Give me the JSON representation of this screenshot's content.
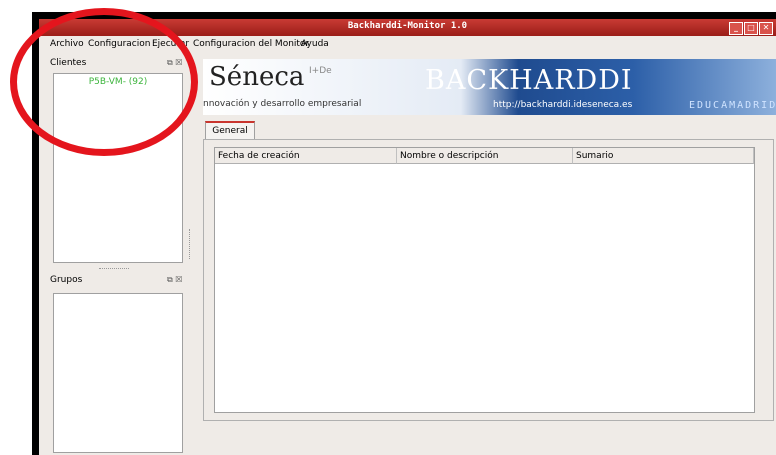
{
  "window": {
    "title": "Backharddi-Monitor 1.0"
  },
  "menu": [
    "Archivo",
    "Configuracion",
    "Ejecutar",
    "Configuracion del Monitor",
    "Ayuda"
  ],
  "clientes": {
    "title": "Clientes",
    "items": [
      "P5B-VM- (92)"
    ]
  },
  "grupos": {
    "title": "Grupos"
  },
  "banner": {
    "seneca": "Séneca",
    "ide": "I+De",
    "tagline": "nnovación y desarrollo empresarial",
    "backharddi": "BACKHARDDI",
    "url": "http://backharddi.ideseneca.es",
    "educa": "EDUCAMADRID"
  },
  "tabs": [
    {
      "label": "General"
    }
  ],
  "table": {
    "columns": [
      "Fecha de creación",
      "Nombre o descripción",
      "Sumario"
    ]
  },
  "colors": {
    "title_bar": "#b3261e",
    "annotation_circle": "#e4151d",
    "client_text": "#3cb43c"
  }
}
